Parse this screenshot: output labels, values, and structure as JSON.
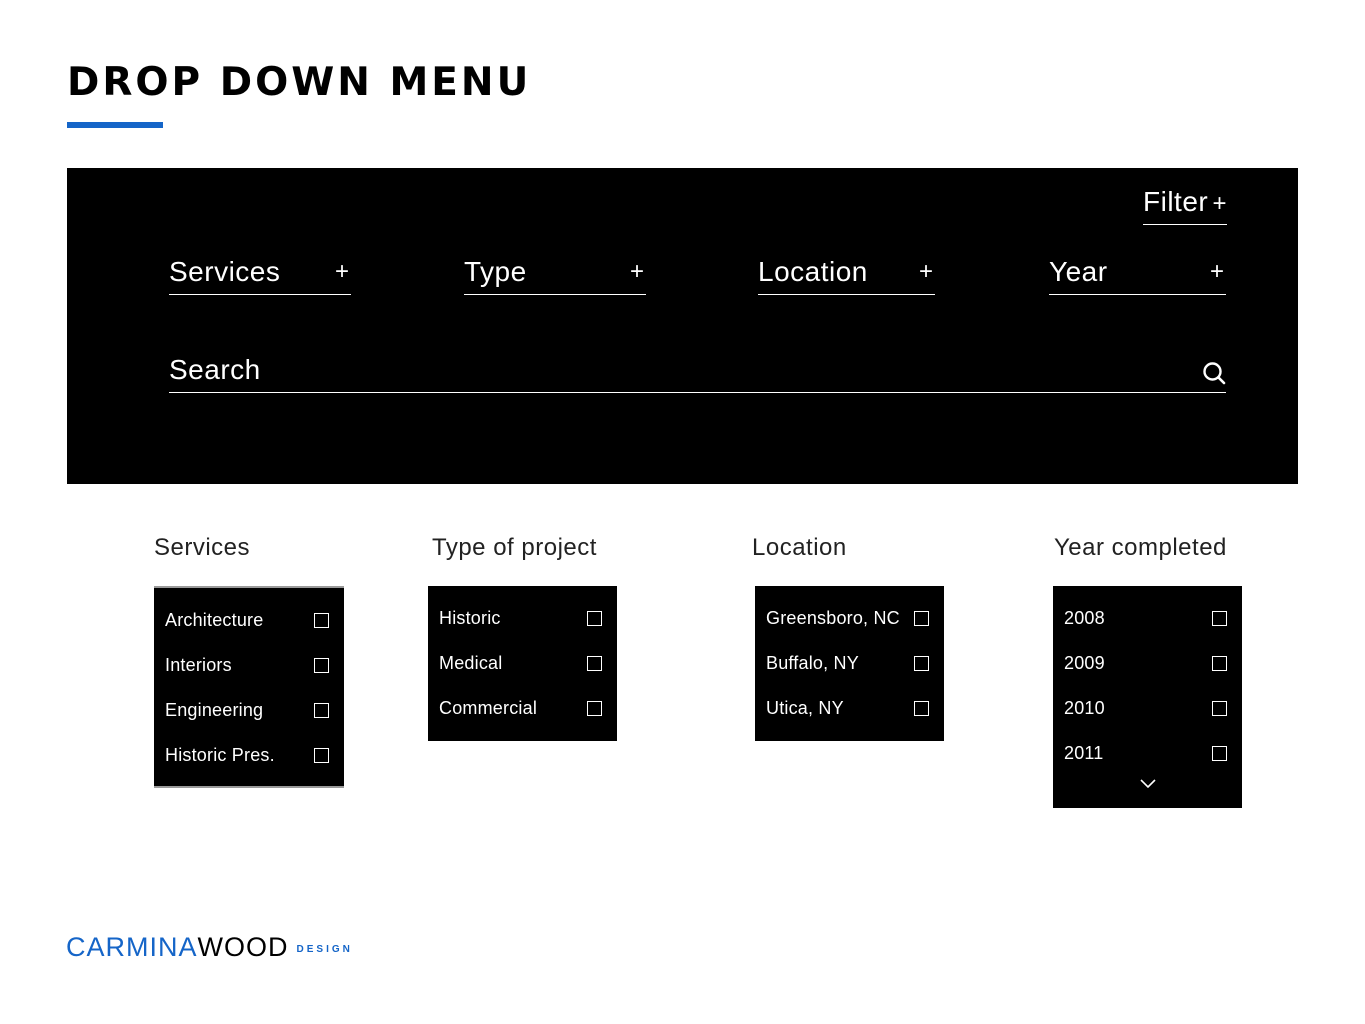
{
  "page": {
    "title": "DROP DOWN MENU"
  },
  "colors": {
    "accent": "#1565c8",
    "panel": "#000000",
    "text_on_panel": "#ffffff"
  },
  "filter_panel": {
    "filter_label": "Filter",
    "plus": "+",
    "dropdowns": [
      {
        "label": "Services",
        "icon": "plus-icon"
      },
      {
        "label": "Type",
        "icon": "plus-icon"
      },
      {
        "label": "Location",
        "icon": "plus-icon"
      },
      {
        "label": "Year",
        "icon": "plus-icon"
      }
    ],
    "search": {
      "placeholder": "Search",
      "value": "",
      "icon": "search-icon"
    }
  },
  "menus": [
    {
      "heading": "Services",
      "items": [
        "Architecture",
        "Interiors",
        "Engineering",
        "Historic Pres."
      ]
    },
    {
      "heading": "Type of project",
      "items": [
        "Historic",
        "Medical",
        "Commercial"
      ]
    },
    {
      "heading": "Location",
      "items": [
        "Greensboro, NC",
        "Buffalo, NY",
        "Utica, NY"
      ]
    },
    {
      "heading": "Year completed",
      "items": [
        "2008",
        "2009",
        "2010",
        "2011"
      ],
      "more_icon": "chevron-down-icon"
    }
  ],
  "logo": {
    "part1": "CARMINA",
    "part2": "WOOD",
    "part3": "DESIGN"
  }
}
